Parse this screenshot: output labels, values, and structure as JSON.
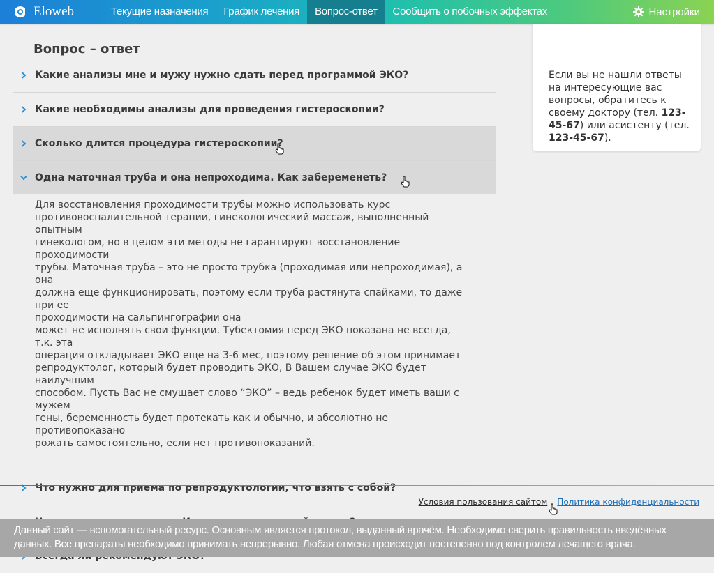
{
  "app": {
    "name": "Eloweb"
  },
  "nav": {
    "items": [
      {
        "label": "Текущие назначения"
      },
      {
        "label": "График лечения"
      },
      {
        "label": "Вопрос-ответ"
      },
      {
        "label": "Сообщить о побочных эффектах"
      }
    ],
    "active_index": 2,
    "settings_label": "Настройки"
  },
  "page": {
    "title": "Вопрос – ответ"
  },
  "faq": [
    {
      "question": "Какие анализы мне и мужу нужно сдать перед программой ЭКО?",
      "state": "collapsed"
    },
    {
      "question": "Какие необходимы анализы для проведения гистероскопии?",
      "state": "collapsed"
    },
    {
      "question": "Сколько длится процедура гистероскопии?",
      "state": "hover"
    },
    {
      "question": "Одна маточная труба и она непроходима. Как забеременеть?",
      "state": "expanded",
      "answer": "Для восстановления проходимости трубы можно использовать курс\nпротивовоспалительной терапии, гинекологический массаж, выполненный опытным\nгинекологом, но в целом эти методы не гарантируют восстановление проходимости\nтрубы. Маточная труба – это не просто трубка (проходимая или непроходимая), а она\nдолжна еще функционировать, поэтому если труба растянута спайками, то даже при ее\nпроходимости на сальпингографии она\nможет не исполнять свои функции. Тубектомия перед ЭКО показана не всегда, т.к. эта\nоперация откладывает ЭКО еще на 3-6 мес, поэтому решение об этом принимает\nрепродуктолог, который будет проводить ЭКО, В Вашем случае ЭКО будет наилучшим\nспособом. Пусть Вас не смущает слово “ЭКО” – ведь ребенок будет иметь ваши с мужем\nгены, беременность будет протекать как и обычно, и абсолютно не противопоказано\nрожать самостоятельно, если нет противопоказаний."
    },
    {
      "question": "Что нужно для приема по репродуктологии, что взять с собой?",
      "state": "collapsed"
    },
    {
      "question": "Что входит в программу «Инсеминация спермой мужа»?",
      "state": "collapsed"
    },
    {
      "question": "Всегда ли рекомендуют ЭКО?",
      "state": "collapsed"
    }
  ],
  "sidebar": {
    "text_1": "Если вы не нашли ответы на интересующие вас вопросы, обратитесь к своему доктору (тел. ",
    "doctor_phone": "123-45-67",
    "text_2": ") или асистенту (тел. ",
    "assistant_phone": "123-45-67",
    "text_3": ")."
  },
  "footer": {
    "terms_label": "Условия пользования сайтом",
    "privacy_label": "Политика конфиденциальности",
    "disclaimer": "Данный сайт — вспомогательный ресурс. Основным является протокол, выданный врачём. Необходимо сверить правильность введённых данных. Все препараты необходимо принимать непрерывно.  Любая отмена происходит постепенно под контролем лечащего врача."
  },
  "colors": {
    "nav_active": "#167f8f",
    "chevron": "#2a8fd6",
    "link": "#1f6fb5"
  }
}
